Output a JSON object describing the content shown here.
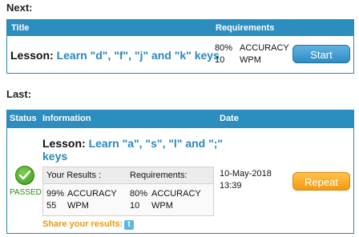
{
  "next": {
    "heading": "Next:",
    "columns": {
      "title": "Title",
      "requirements": "Requirements"
    },
    "lesson_prefix": "Lesson:",
    "lesson_name": "Learn \"d\", \"f\", \"j\" and \"k\" keys",
    "req_accuracy_value": "80%",
    "req_accuracy_label": "ACCURACY",
    "req_wpm_value": "10",
    "req_wpm_label": "WPM",
    "start_label": "Start"
  },
  "last": {
    "heading": "Last:",
    "columns": {
      "status": "Status",
      "information": "Information",
      "date": "Date"
    },
    "status_text": "PASSED",
    "lesson_prefix": "Lesson:",
    "lesson_name_line1": "Learn \"a\", \"s\", \"l\" and \";\"",
    "lesson_name_line2": "keys",
    "your_results_label": "Your Results :",
    "requirements_label": "Requirements:",
    "result_accuracy_value": "99%",
    "result_accuracy_label": "ACCURACY",
    "result_wpm_value": "55",
    "result_wpm_label": "WPM",
    "req_accuracy_value": "80%",
    "req_accuracy_label": "ACCURACY",
    "req_wpm_value": "10",
    "req_wpm_label": "WPM",
    "date_line1": "10-May-2018",
    "date_line2": "13:39",
    "repeat_label": "Repeat",
    "share_label": "Share your results:",
    "twitter_glyph": "t"
  }
}
